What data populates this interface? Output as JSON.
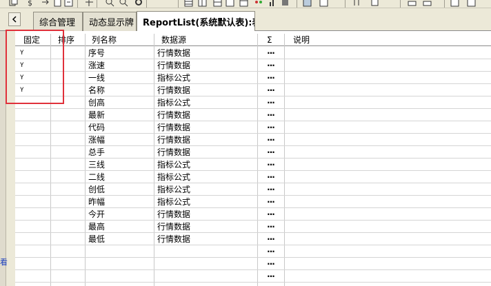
{
  "toolbar": {
    "buttons": [
      "copy-icon",
      "dollar-icon",
      "arrow-icon",
      "paste-icon",
      "export-icon",
      "move-icon",
      "zoom-in-icon",
      "search-icon",
      "gear-icon",
      "grid-icon",
      "grid2-icon",
      "grid3-icon",
      "grid4-icon",
      "layout-icon",
      "dots-icon",
      "chart-icon",
      "stamp-icon",
      "sort-icon",
      "bar-icon",
      "window-icon",
      "window2-icon"
    ]
  },
  "tabs": [
    {
      "label": "综合管理"
    },
    {
      "label": "动态显示牌"
    },
    {
      "label": "ReportList(系统默认表):表"
    }
  ],
  "grid": {
    "headers": {
      "fixed": "固定",
      "sort": "排序",
      "name": "列名称",
      "source": "数据源",
      "sigma": "Σ",
      "note": "说明"
    },
    "rows": [
      {
        "fixed": "Y",
        "sort": "",
        "name": "序号",
        "source": "行情数据",
        "sigma": "···",
        "note": ""
      },
      {
        "fixed": "Y",
        "sort": "",
        "name": "涨速",
        "source": "行情数据",
        "sigma": "···",
        "note": ""
      },
      {
        "fixed": "Y",
        "sort": "",
        "name": "一线",
        "source": "指标公式",
        "sigma": "···",
        "note": ""
      },
      {
        "fixed": "Y",
        "sort": "",
        "name": "名称",
        "source": "行情数据",
        "sigma": "···",
        "note": ""
      },
      {
        "fixed": "",
        "sort": "",
        "name": "创高",
        "source": "指标公式",
        "sigma": "···",
        "note": ""
      },
      {
        "fixed": "",
        "sort": "",
        "name": "最新",
        "source": "行情数据",
        "sigma": "···",
        "note": ""
      },
      {
        "fixed": "",
        "sort": "",
        "name": "代码",
        "source": "行情数据",
        "sigma": "···",
        "note": ""
      },
      {
        "fixed": "",
        "sort": "",
        "name": "涨幅",
        "source": "行情数据",
        "sigma": "···",
        "note": ""
      },
      {
        "fixed": "",
        "sort": "",
        "name": "总手",
        "source": "行情数据",
        "sigma": "···",
        "note": ""
      },
      {
        "fixed": "",
        "sort": "",
        "name": "三线",
        "source": "指标公式",
        "sigma": "···",
        "note": ""
      },
      {
        "fixed": "",
        "sort": "",
        "name": "二线",
        "source": "指标公式",
        "sigma": "···",
        "note": ""
      },
      {
        "fixed": "",
        "sort": "",
        "name": "创低",
        "source": "指标公式",
        "sigma": "···",
        "note": ""
      },
      {
        "fixed": "",
        "sort": "",
        "name": "昨幅",
        "source": "指标公式",
        "sigma": "···",
        "note": ""
      },
      {
        "fixed": "",
        "sort": "",
        "name": "今开",
        "source": "行情数据",
        "sigma": "···",
        "note": ""
      },
      {
        "fixed": "",
        "sort": "",
        "name": "最高",
        "source": "行情数据",
        "sigma": "···",
        "note": ""
      },
      {
        "fixed": "",
        "sort": "",
        "name": "最低",
        "source": "行情数据",
        "sigma": "···",
        "note": ""
      },
      {
        "fixed": "",
        "sort": "",
        "name": "",
        "source": "",
        "sigma": "···",
        "note": ""
      },
      {
        "fixed": "",
        "sort": "",
        "name": "",
        "source": "",
        "sigma": "···",
        "note": ""
      },
      {
        "fixed": "",
        "sort": "",
        "name": "",
        "source": "",
        "sigma": "···",
        "note": ""
      },
      {
        "fixed": "",
        "sort": "",
        "name": "",
        "source": "",
        "sigma": "···",
        "note": ""
      }
    ]
  },
  "gutter": {
    "glyph": "看"
  },
  "colors": {
    "highlight": "#e0303a",
    "toolbar_bg": "#ece9d8",
    "link": "#1a3fbf"
  }
}
